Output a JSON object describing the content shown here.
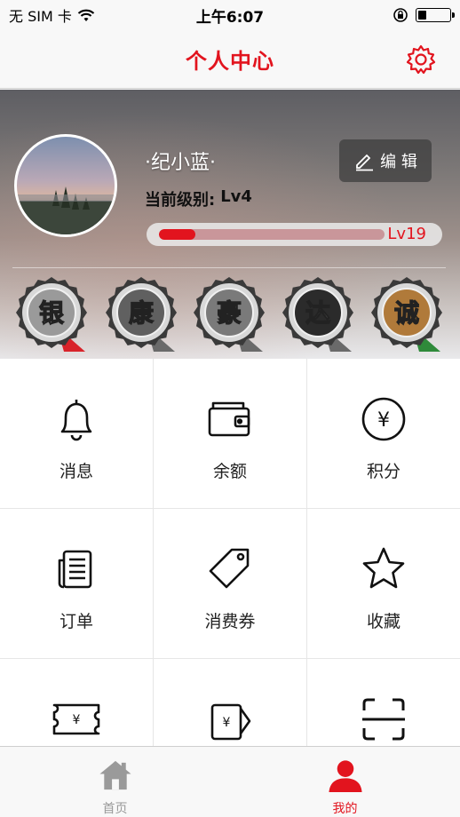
{
  "status_bar": {
    "carrier": "无 SIM 卡",
    "time": "上午6:07",
    "battery_level": 0.25,
    "wifi_icon": "wifi-icon",
    "lock_icon": "rotation-lock-icon"
  },
  "nav": {
    "title": "个人中心",
    "settings_icon": "gear-icon"
  },
  "profile": {
    "username": "·纪小蓝·",
    "level_label": "当前级别:",
    "level_value": "Lv4",
    "edit_label": "编 辑",
    "next_level": "Lv19",
    "progress": 0.16,
    "badges": [
      {
        "char": "银",
        "color": "#9a9a9a",
        "ribbon": "#d8232a"
      },
      {
        "char": "康",
        "color": "#606060",
        "ribbon": "#6a6a6a"
      },
      {
        "char": "豪",
        "color": "#7a7a7a",
        "ribbon": "#6a6a6a"
      },
      {
        "char": "达",
        "color": "#2b2b2b",
        "ribbon": "#6a6a6a"
      },
      {
        "char": "诚",
        "color": "#b07a3a",
        "ribbon": "#2f8a3a"
      }
    ]
  },
  "grid": [
    {
      "label": "消息",
      "icon": "bell-icon"
    },
    {
      "label": "余额",
      "icon": "wallet-icon"
    },
    {
      "label": "积分",
      "icon": "yen-coin-icon"
    },
    {
      "label": "订单",
      "icon": "order-list-icon"
    },
    {
      "label": "消费券",
      "icon": "coupon-tag-icon"
    },
    {
      "label": "收藏",
      "icon": "star-icon"
    },
    {
      "label": "",
      "icon": "ticket-yen-icon"
    },
    {
      "label": "",
      "icon": "envelope-yen-icon"
    },
    {
      "label": "",
      "icon": "scan-icon"
    }
  ],
  "tabs": [
    {
      "label": "首页",
      "icon": "home-icon",
      "active": false
    },
    {
      "label": "我的",
      "icon": "user-icon",
      "active": true
    }
  ],
  "colors": {
    "accent": "#e2141e",
    "tab_inactive": "#999999"
  }
}
